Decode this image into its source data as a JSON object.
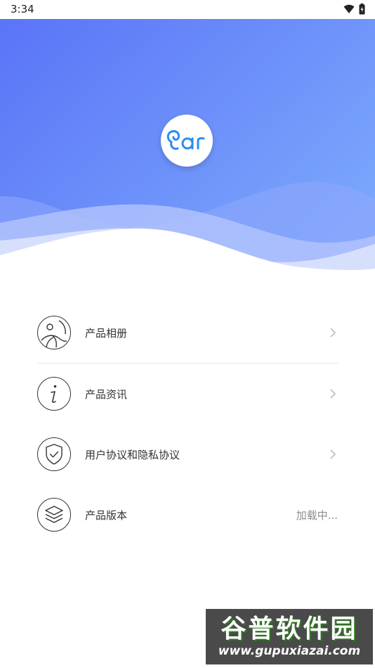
{
  "status": {
    "time": "3:34"
  },
  "logo": {
    "text": "ear"
  },
  "menu": {
    "items": [
      {
        "label": "产品相册",
        "icon": "photo-album-icon"
      },
      {
        "label": "产品资讯",
        "icon": "info-icon"
      },
      {
        "label": "用户协议和隐私协议",
        "icon": "shield-check-icon"
      },
      {
        "label": "产品版本",
        "icon": "layers-icon",
        "value": "加载中..."
      }
    ]
  },
  "watermark": {
    "title": "谷普软件园",
    "url": "www.gupuxiazai.com"
  },
  "colors": {
    "hero_start": "#5a74f7",
    "hero_end": "#7aa6fc",
    "text": "#333333",
    "muted": "#8c8c8c",
    "divider": "#e6e6e6",
    "watermark_bg": "#4a4a4a"
  }
}
